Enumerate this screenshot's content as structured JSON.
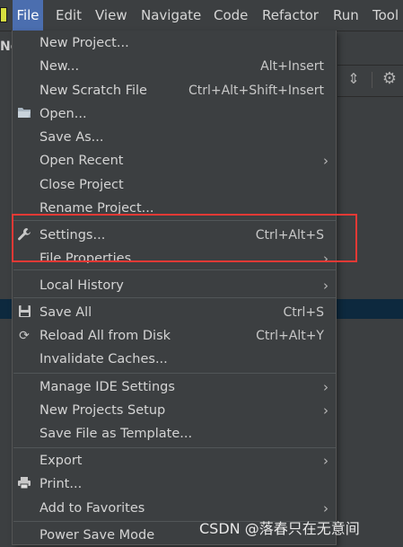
{
  "menubar": {
    "items": [
      "File",
      "Edit",
      "View",
      "Navigate",
      "Code",
      "Refactor",
      "Run",
      "Tool"
    ],
    "active": "File"
  },
  "background": {
    "left_label": "No"
  },
  "file_menu": {
    "items": [
      {
        "label": "New Project...",
        "shortcut": "",
        "submenu": false,
        "icon": ""
      },
      {
        "label": "New...",
        "shortcut": "Alt+Insert",
        "submenu": false,
        "icon": ""
      },
      {
        "label": "New Scratch File",
        "shortcut": "Ctrl+Alt+Shift+Insert",
        "submenu": false,
        "icon": ""
      },
      {
        "label": "Open...",
        "shortcut": "",
        "submenu": false,
        "icon": "folder-icon"
      },
      {
        "label": "Save As...",
        "shortcut": "",
        "submenu": false,
        "icon": ""
      },
      {
        "label": "Open Recent",
        "shortcut": "",
        "submenu": true,
        "icon": ""
      },
      {
        "label": "Close Project",
        "shortcut": "",
        "submenu": false,
        "icon": ""
      },
      {
        "label": "Rename Project...",
        "shortcut": "",
        "submenu": false,
        "icon": ""
      },
      {
        "label": "Settings...",
        "shortcut": "Ctrl+Alt+S",
        "submenu": false,
        "icon": "wrench-icon"
      },
      {
        "label": "File Properties",
        "shortcut": "",
        "submenu": true,
        "icon": ""
      },
      {
        "label": "Local History",
        "shortcut": "",
        "submenu": true,
        "icon": ""
      },
      {
        "label": "Save All",
        "shortcut": "Ctrl+S",
        "submenu": false,
        "icon": "floppy-icon"
      },
      {
        "label": "Reload All from Disk",
        "shortcut": "Ctrl+Alt+Y",
        "submenu": false,
        "icon": "reload-icon"
      },
      {
        "label": "Invalidate Caches...",
        "shortcut": "",
        "submenu": false,
        "icon": ""
      },
      {
        "label": "Manage IDE Settings",
        "shortcut": "",
        "submenu": true,
        "icon": ""
      },
      {
        "label": "New Projects Setup",
        "shortcut": "",
        "submenu": true,
        "icon": ""
      },
      {
        "label": "Save File as Template...",
        "shortcut": "",
        "submenu": false,
        "icon": ""
      },
      {
        "label": "Export",
        "shortcut": "",
        "submenu": true,
        "icon": ""
      },
      {
        "label": "Print...",
        "shortcut": "",
        "submenu": false,
        "icon": "printer-icon"
      },
      {
        "label": "Add to Favorites",
        "shortcut": "",
        "submenu": true,
        "icon": ""
      },
      {
        "label": "Power Save Mode",
        "shortcut": "",
        "submenu": false,
        "icon": ""
      }
    ]
  },
  "watermark": "CSDN @落春只在无意间",
  "colors": {
    "menu_bg": "#3c3f41",
    "active_menu": "#4b6eaf",
    "highlight_border": "#e53935",
    "selection_bg": "#0d293e",
    "app_badge": "#d7de3f"
  }
}
